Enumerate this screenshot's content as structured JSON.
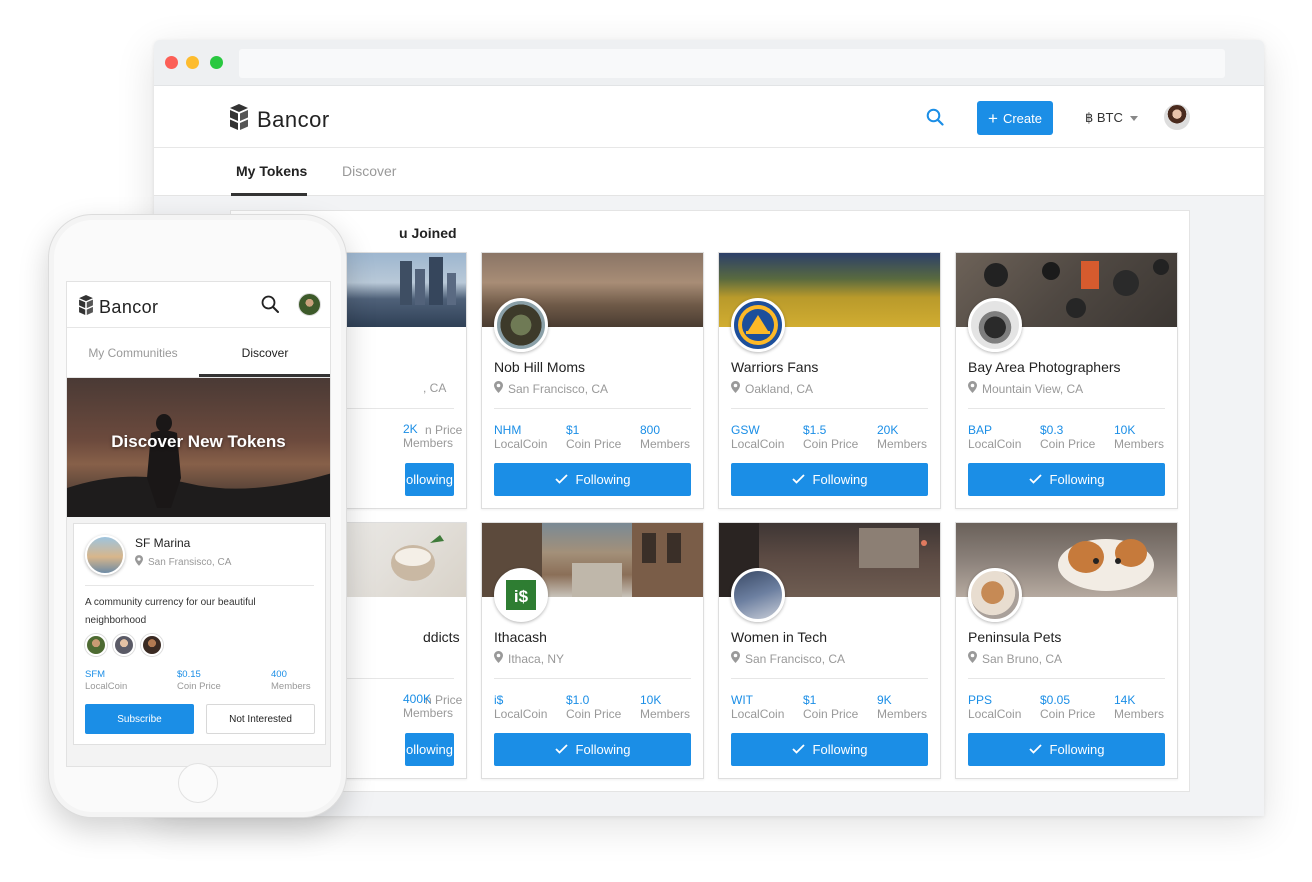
{
  "colors": {
    "accent": "#1b8ee6",
    "text": "#222222",
    "muted": "#999999"
  },
  "desktop": {
    "brand": {
      "name": "Bancor",
      "logo_icon": "bancor-logo-icon"
    },
    "header": {
      "search_icon": "search-icon",
      "create_label": "Create",
      "currency": "฿ BTC"
    },
    "tabs": [
      {
        "label": "My Tokens",
        "active": true
      },
      {
        "label": "Discover",
        "active": false
      }
    ],
    "section_title": "u Joined",
    "cards": [
      {
        "name": "",
        "location": ", CA",
        "stats": [
          {
            "value": "",
            "label": ""
          },
          {
            "value": "",
            "label": "n Price"
          },
          {
            "value": "2K",
            "label": "Members"
          }
        ],
        "button": "ollowing",
        "partial": true
      },
      {
        "name": "Nob Hill Moms",
        "location": "San Francisco, CA",
        "stats": [
          {
            "value": "NHM",
            "label": "LocalCoin"
          },
          {
            "value": "$1",
            "label": "Coin Price"
          },
          {
            "value": "800",
            "label": "Members"
          }
        ],
        "button": "Following"
      },
      {
        "name": "Warriors Fans",
        "location": "Oakland, CA",
        "stats": [
          {
            "value": "GSW",
            "label": "LocalCoin"
          },
          {
            "value": "$1.5",
            "label": "Coin Price"
          },
          {
            "value": "20K",
            "label": "Members"
          }
        ],
        "button": "Following"
      },
      {
        "name": "Bay Area Photographers",
        "location": "Mountain View, CA",
        "stats": [
          {
            "value": "BAP",
            "label": "LocalCoin"
          },
          {
            "value": "$0.3",
            "label": "Coin Price"
          },
          {
            "value": "10K",
            "label": "Members"
          }
        ],
        "button": "Following"
      },
      {
        "name": "ddicts",
        "location": "",
        "stats": [
          {
            "value": "",
            "label": ""
          },
          {
            "value": "",
            "label": "n Price"
          },
          {
            "value": "400K",
            "label": "Members"
          }
        ],
        "button": "ollowing",
        "partial": true
      },
      {
        "name": "Ithacash",
        "location": "Ithaca, NY",
        "badge_text": "i$",
        "stats": [
          {
            "value": "i$",
            "label": "LocalCoin"
          },
          {
            "value": "$1.0",
            "label": "Coin Price"
          },
          {
            "value": "10K",
            "label": "Members"
          }
        ],
        "button": "Following"
      },
      {
        "name": "Women in Tech",
        "location": "San Francisco, CA",
        "stats": [
          {
            "value": "WIT",
            "label": "LocalCoin"
          },
          {
            "value": "$1",
            "label": "Coin Price"
          },
          {
            "value": "9K",
            "label": "Members"
          }
        ],
        "button": "Following"
      },
      {
        "name": "Peninsula Pets",
        "location": "San Bruno, CA",
        "stats": [
          {
            "value": "PPS",
            "label": "LocalCoin"
          },
          {
            "value": "$0.05",
            "label": "Coin Price"
          },
          {
            "value": "14K",
            "label": "Members"
          }
        ],
        "button": "Following"
      }
    ]
  },
  "mobile": {
    "brand": {
      "name": "Bancor"
    },
    "tabs": [
      {
        "label": "My Communities",
        "active": false
      },
      {
        "label": "Discover",
        "active": true
      }
    ],
    "hero_title": "Discover New Tokens",
    "card": {
      "name": "SF Marina",
      "location": "San Fransisco, CA",
      "description": "A community currency for our beautiful neighborhood",
      "stats": [
        {
          "value": "SFM",
          "label": "LocalCoin"
        },
        {
          "value": "$0.15",
          "label": "Coin Price"
        },
        {
          "value": "400",
          "label": "Members"
        }
      ],
      "subscribe_label": "Subscribe",
      "not_interested_label": "Not Interested"
    }
  }
}
